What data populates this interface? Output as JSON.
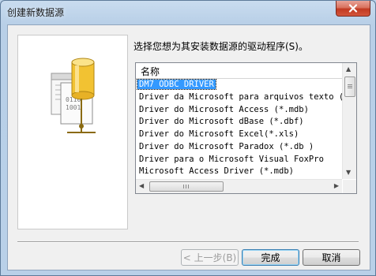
{
  "window": {
    "title": "创建新数据源",
    "close_icon": "close-icon"
  },
  "instruction": "选择您想为其安装数据源的驱动程序(S)。",
  "list": {
    "column_header": "名称",
    "items": [
      "DM7 ODBC DRIVER",
      "Driver da Microsoft para arquivos texto (*.",
      "Driver do Microsoft Access (*.mdb)",
      "Driver do Microsoft dBase (*.dbf)",
      "Driver do Microsoft Excel(*.xls)",
      "Driver do Microsoft Paradox (*.db )",
      "Driver para o Microsoft Visual FoxPro",
      "Microsoft Access Driver (*.mdb)"
    ],
    "selected_index": 0
  },
  "buttons": {
    "back": "< 上一步(B)",
    "finish": "完成",
    "cancel": "取消"
  },
  "colors": {
    "selection": "#3399ff",
    "close_button": "#c13a22",
    "title_bar": "#b9d0e8"
  }
}
